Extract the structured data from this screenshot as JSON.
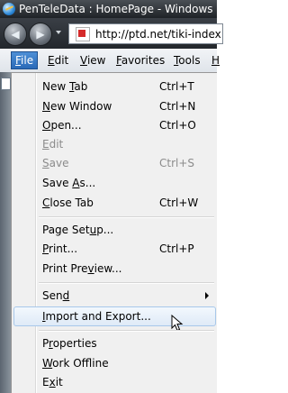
{
  "window": {
    "title": "PenTeleData : HomePage - Windows Inte"
  },
  "nav": {
    "back_icon": "back-arrow-icon",
    "forward_icon": "forward-arrow-icon",
    "address": "http://ptd.net/tiki-index.p"
  },
  "menubar": {
    "items": [
      {
        "label": "File",
        "accel": "F",
        "rest": "ile"
      },
      {
        "label": "Edit",
        "accel": "E",
        "rest": "dit"
      },
      {
        "label": "View",
        "accel": "V",
        "rest": "iew"
      },
      {
        "label": "Favorites",
        "accel": "F",
        "rest": "avorites"
      },
      {
        "label": "Tools",
        "accel": "T",
        "rest": "ools"
      },
      {
        "label": "H",
        "accel": "H",
        "rest": ""
      }
    ]
  },
  "file_menu": {
    "items": [
      {
        "label_pre": "New ",
        "accel": "T",
        "label_post": "ab",
        "shortcut": "Ctrl+T",
        "enabled": true
      },
      {
        "label_pre": "",
        "accel": "N",
        "label_post": "ew Window",
        "shortcut": "Ctrl+N",
        "enabled": true
      },
      {
        "label_pre": "",
        "accel": "O",
        "label_post": "pen...",
        "shortcut": "Ctrl+O",
        "enabled": true
      },
      {
        "label_pre": "",
        "accel": "E",
        "label_post": "dit",
        "shortcut": "",
        "enabled": false
      },
      {
        "label_pre": "",
        "accel": "S",
        "label_post": "ave",
        "shortcut": "Ctrl+S",
        "enabled": false
      },
      {
        "label_pre": "Save ",
        "accel": "A",
        "label_post": "s...",
        "shortcut": "",
        "enabled": true
      },
      {
        "label_pre": "",
        "accel": "C",
        "label_post": "lose Tab",
        "shortcut": "Ctrl+W",
        "enabled": true
      },
      {
        "label_pre": "Page Set",
        "accel": "u",
        "label_post": "p...",
        "shortcut": "",
        "enabled": true
      },
      {
        "label_pre": "",
        "accel": "P",
        "label_post": "rint...",
        "shortcut": "Ctrl+P",
        "enabled": true
      },
      {
        "label_pre": "Print Pre",
        "accel": "v",
        "label_post": "iew...",
        "shortcut": "",
        "enabled": true
      },
      {
        "label_pre": "Sen",
        "accel": "d",
        "label_post": "",
        "shortcut": "",
        "enabled": true,
        "submenu": true
      },
      {
        "label_pre": "",
        "accel": "I",
        "label_post": "mport and Export...",
        "shortcut": "",
        "enabled": true,
        "highlighted": true
      },
      {
        "label_pre": "P",
        "accel": "r",
        "label_post": "operties",
        "shortcut": "",
        "enabled": true
      },
      {
        "label_pre": "",
        "accel": "W",
        "label_post": "ork Offline",
        "shortcut": "",
        "enabled": true
      },
      {
        "label_pre": "E",
        "accel": "x",
        "label_post": "it",
        "shortcut": "",
        "enabled": true
      }
    ]
  },
  "colors": {
    "highlight_border": "#a8c8ea",
    "menu_active": "#2a6ab8",
    "disabled_text": "#8b8b8b"
  }
}
